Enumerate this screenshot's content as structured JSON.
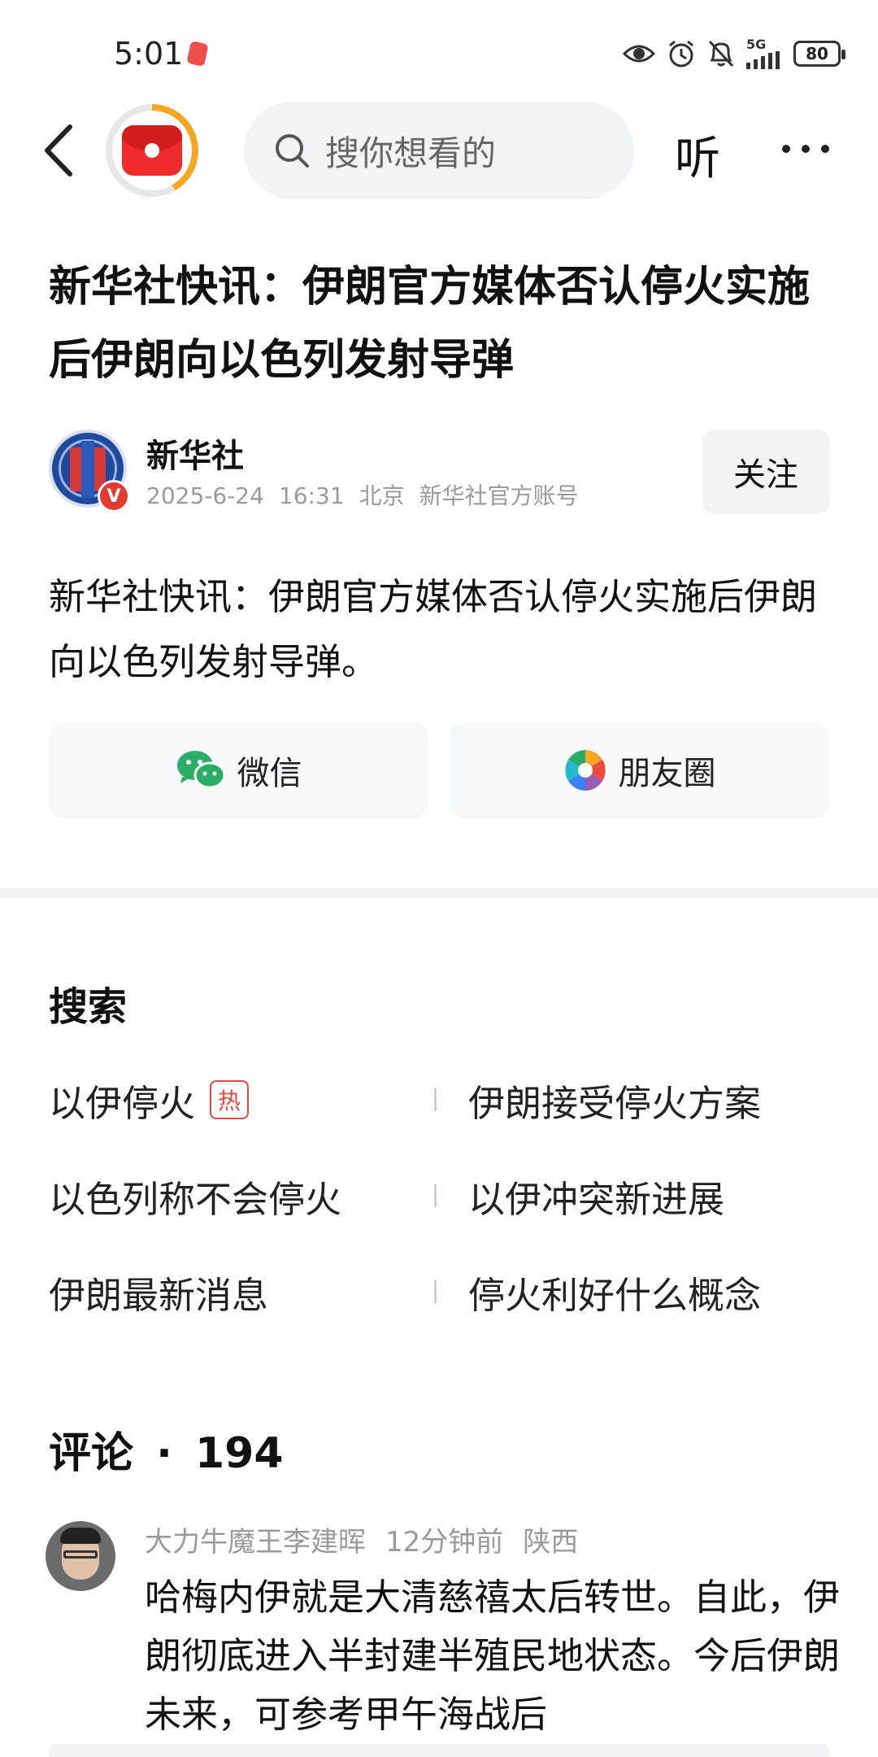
{
  "status_bar": {
    "time": "5:01",
    "network": "5G",
    "battery": "80",
    "icons": [
      "eye-icon",
      "alarm-icon",
      "mute-icon",
      "signal-icon",
      "battery-icon"
    ]
  },
  "nav": {
    "search_placeholder": "搜你想看的",
    "listen_label": "听",
    "icons": [
      "back-arrow-icon",
      "red-envelope-icon",
      "search-icon",
      "more-icon"
    ]
  },
  "article": {
    "title": "新华社快讯：伊朗官方媒体否认停火实施后伊朗向以色列发射导弹",
    "author": {
      "name": "新华社",
      "date": "2025-6-24",
      "time": "16:31",
      "location": "北京",
      "account_type": "新华社官方账号",
      "verified_mark": "V",
      "follow_label": "关注"
    },
    "body": "新华社快讯：伊朗官方媒体否认停火实施后伊朗向以色列发射导弹。"
  },
  "share": {
    "wechat_label": "微信",
    "moments_label": "朋友圈"
  },
  "search_section": {
    "title": "搜索",
    "hot_tag": "热",
    "items": [
      {
        "left": "以伊停火",
        "right": "伊朗接受停火方案"
      },
      {
        "left": "以色列称不会停火",
        "right": "以伊冲突新进展"
      },
      {
        "left": "伊朗最新消息",
        "right": "停火利好什么概念"
      }
    ]
  },
  "comments": {
    "title": "评论",
    "separator": "·",
    "count": "194",
    "items": [
      {
        "user": "大力牛魔王李建晖",
        "time": "12分钟前",
        "location": "陕西",
        "text": "哈梅内伊就是大清慈禧太后转世。自此，伊朗彻底进入半封建半殖民地状态。今后伊朗未来，可参考甲午海战后"
      }
    ]
  },
  "colors": {
    "accent_red": "#e43a2f",
    "wechat_green": "#2aae67",
    "meta_gray": "#9a9a9a",
    "button_bg": "#f2f3f5"
  }
}
